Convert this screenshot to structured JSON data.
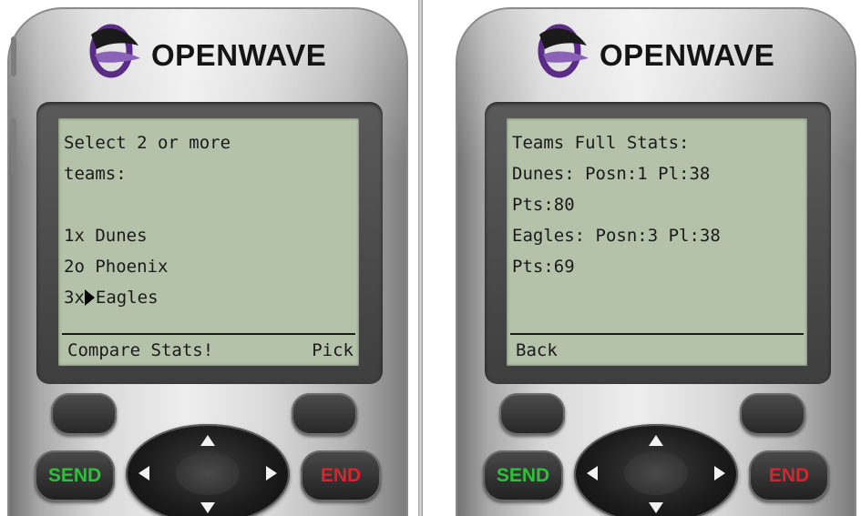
{
  "colors": {
    "screen_bg": "#b4c2aa",
    "send_label": "#2fbf3a",
    "end_label": "#d8242c",
    "logo_purple": "#5b2c86"
  },
  "phones": [
    {
      "brand": "OPENWAVE",
      "screen_lines": [
        "Select 2 or more",
        "teams:",
        "",
        "1x Dunes",
        "2o Phoenix",
        "3xEagles"
      ],
      "selected_item_index": 5,
      "softkey_left": "Compare Stats!",
      "softkey_right": "Pick",
      "send_label": "SEND",
      "end_label": "END"
    },
    {
      "brand": "OPENWAVE",
      "screen_lines": [
        "Teams Full Stats:",
        "Dunes: Posn:1 Pl:38",
        "Pts:80",
        "Eagles: Posn:3 Pl:38",
        "Pts:69"
      ],
      "softkey_left": "Back",
      "softkey_right": "",
      "send_label": "SEND",
      "end_label": "END"
    }
  ],
  "icons": [
    "openwave-logo-icon",
    "cursor-arrow-icon",
    "nav-up-icon",
    "nav-down-icon",
    "nav-left-icon",
    "nav-right-icon"
  ]
}
